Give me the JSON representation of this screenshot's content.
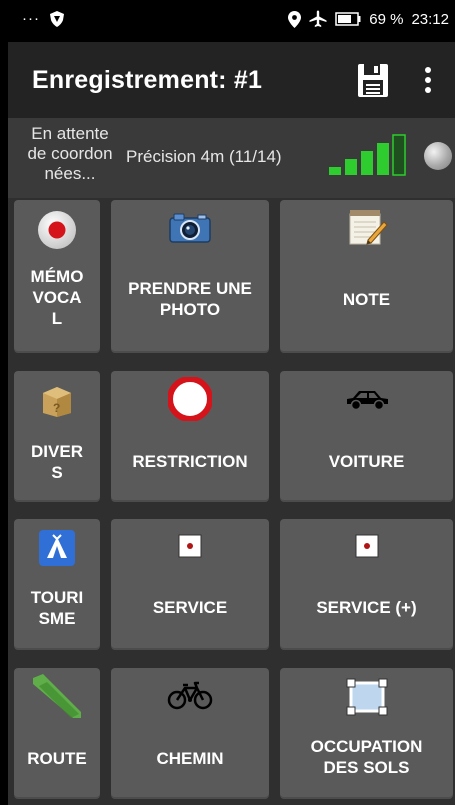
{
  "status_bar": {
    "overflow": "···",
    "battery_percent": "69 %",
    "time": "23:12"
  },
  "app_bar": {
    "title": "Enregistrement: #1",
    "save_icon": "floppy-disk-icon",
    "menu_icon": "more-vert-icon"
  },
  "info": {
    "waiting_text": "En attente de coordon nées...",
    "waiting_lines": [
      "En attente",
      "de coordon",
      "nées..."
    ],
    "precision": "Précision 4m (11/14)",
    "signal_level": 4,
    "signal_bars_total": 5
  },
  "tiles": [
    {
      "label": "MÉMO VOCA L",
      "lines": [
        "MÉMO",
        "VOCA",
        "L"
      ],
      "icon": "record-icon"
    },
    {
      "label": "PRENDRE UNE PHOTO",
      "lines": [
        "PRENDRE UNE",
        "PHOTO"
      ],
      "icon": "camera-icon"
    },
    {
      "label": "NOTE",
      "lines": [
        "NOTE"
      ],
      "icon": "notepad-icon"
    },
    {
      "label": "DIVER S",
      "lines": [
        "DIVER",
        "S"
      ],
      "icon": "mystery-box-icon"
    },
    {
      "label": "RESTRICTION",
      "lines": [
        "RESTRICTION"
      ],
      "icon": "no-entry-sign-icon"
    },
    {
      "label": "VOITURE",
      "lines": [
        "VOITURE"
      ],
      "icon": "car-icon"
    },
    {
      "label": "TOURI SME",
      "lines": [
        "TOURI",
        "SME"
      ],
      "icon": "camping-tent-icon"
    },
    {
      "label": "SERVICE",
      "lines": [
        "SERVICE"
      ],
      "icon": "service-point-icon"
    },
    {
      "label": "SERVICE (+)",
      "lines": [
        "SERVICE (+)"
      ],
      "icon": "service-point-plus-icon"
    },
    {
      "label": "ROUTE",
      "lines": [
        "ROUTE"
      ],
      "icon": "road-icon"
    },
    {
      "label": "CHEMIN",
      "lines": [
        "CHEMIN"
      ],
      "icon": "bicycle-icon"
    },
    {
      "label": "OCCUPATION DES SOLS",
      "lines": [
        "OCCUPATION",
        "DES SOLS"
      ],
      "icon": "land-use-frame-icon"
    }
  ],
  "colors": {
    "accent_green": "#2ecc2e",
    "tile_bg": "#5a5a5a",
    "app_bar_bg": "#232323",
    "status_bar_bg": "#000000"
  }
}
